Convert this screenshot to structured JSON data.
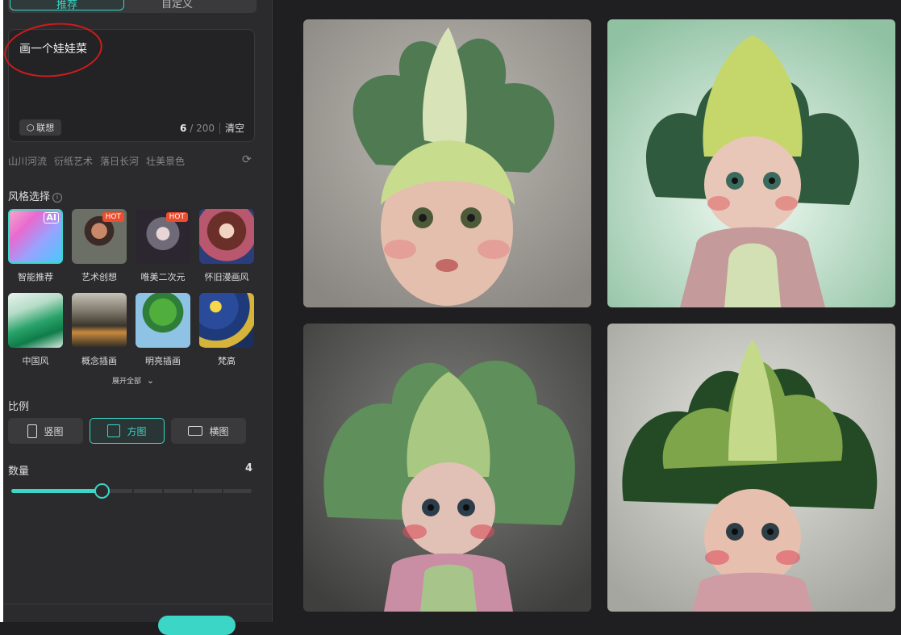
{
  "tabs": {
    "recommend_label": "推荐",
    "custom_label": "自定义"
  },
  "prompt": {
    "text": "画一个娃娃菜",
    "assoc_label": "联想",
    "count_current": "6",
    "count_max": "200",
    "clear_label": "清空"
  },
  "suggestions": [
    "山川河流",
    "衍纸艺术",
    "落日长河",
    "壮美景色"
  ],
  "style_section": {
    "title": "风格选择",
    "items": [
      {
        "label": "智能推荐",
        "badge": "AI"
      },
      {
        "label": "艺术创想",
        "badge": "HOT"
      },
      {
        "label": "唯美二次元",
        "badge": "HOT"
      },
      {
        "label": "怀旧漫画风",
        "badge": ""
      },
      {
        "label": "中国风",
        "badge": ""
      },
      {
        "label": "概念插画",
        "badge": ""
      },
      {
        "label": "明亮插画",
        "badge": ""
      },
      {
        "label": "梵高",
        "badge": ""
      }
    ],
    "expand_label": "展开全部"
  },
  "ratio": {
    "title": "比例",
    "options": [
      {
        "label": "竖图"
      },
      {
        "label": "方图"
      },
      {
        "label": "横图"
      }
    ],
    "selected": "方图"
  },
  "quantity": {
    "title": "数量",
    "value": "4",
    "fraction": 0.375
  },
  "colors": {
    "accent": "#3bd6c6",
    "sidebar_bg": "#2b2b2d",
    "main_bg": "#1f1f21",
    "hot_badge": "#ee4d2d"
  }
}
